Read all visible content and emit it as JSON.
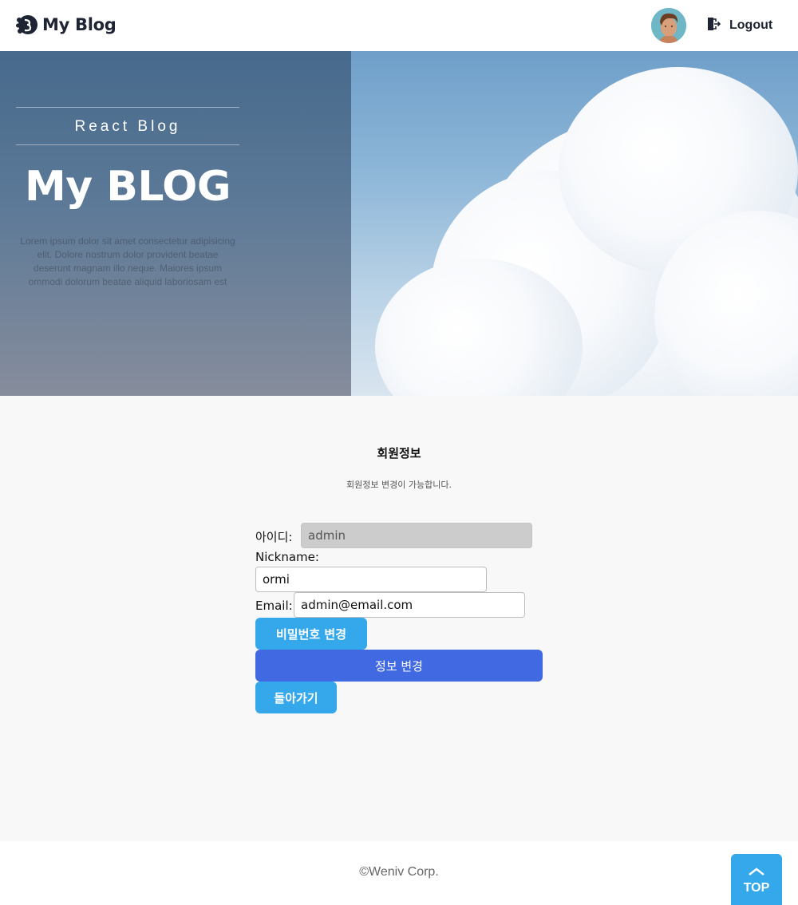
{
  "header": {
    "logo_text": "My Blog",
    "logout_label": "Logout"
  },
  "banner": {
    "subtitle": "React Blog",
    "title": "My BLOG",
    "description": "Lorem ipsum dolor sit amet consectetur adipisicing elit. Dolore nostrum dolor provident beatae deserunt magnam illo neque. Maiores ipsum ommodi dolorum beatae aliquid laboriosam est"
  },
  "main": {
    "title": "회원정보",
    "description": "회원정보 변경이 가능합니다.",
    "form": {
      "id_label": "아이디:",
      "id_value": "admin",
      "nickname_label": "Nickname:",
      "nickname_value": "ormi",
      "email_label": "Email:",
      "email_value": "admin@email.com",
      "change_password_label": "비밀번호 변경",
      "update_info_label": "정보 변경",
      "back_label": "돌아가기"
    }
  },
  "footer": {
    "copyright": "©Weniv Corp.",
    "top_label": "TOP"
  },
  "colors": {
    "accent_sky": "#34a8ea",
    "accent_blue": "#4169e1",
    "brand_dark": "#1e2433"
  },
  "icons": [
    "logo-mark-icon",
    "avatar",
    "logout-icon",
    "chevron-up-icon"
  ]
}
